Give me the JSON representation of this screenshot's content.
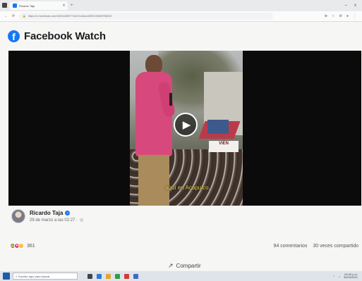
{
  "browser": {
    "tab_title": "Ricardo Taja",
    "tab_close": "x",
    "new_tab": "+",
    "url": "https://m.facebook.com/100044599771487/videos/2892196659788200",
    "window_controls": [
      "–",
      "▫",
      "x"
    ]
  },
  "header": {
    "logo_letter": "f",
    "title": "Facebook Watch"
  },
  "video": {
    "subtitle": "aquí en Acapulco,",
    "banner": "VIEN"
  },
  "post": {
    "author": "Ricardo Taja",
    "date": "29 de marzo a las 02:27 ·",
    "reaction_count": "361",
    "comments": "94 comentarios",
    "shares": "30 veces compartido",
    "share_label": "Compartir"
  },
  "taskbar": {
    "search_placeholder": "Escribe aquí para buscar",
    "clock_time": "09:49 p.m.",
    "clock_date": "30/04/2021"
  },
  "colors": {
    "facebook_blue": "#1877f2",
    "love_red": "#e83a55",
    "haha_yellow": "#f7b125"
  }
}
